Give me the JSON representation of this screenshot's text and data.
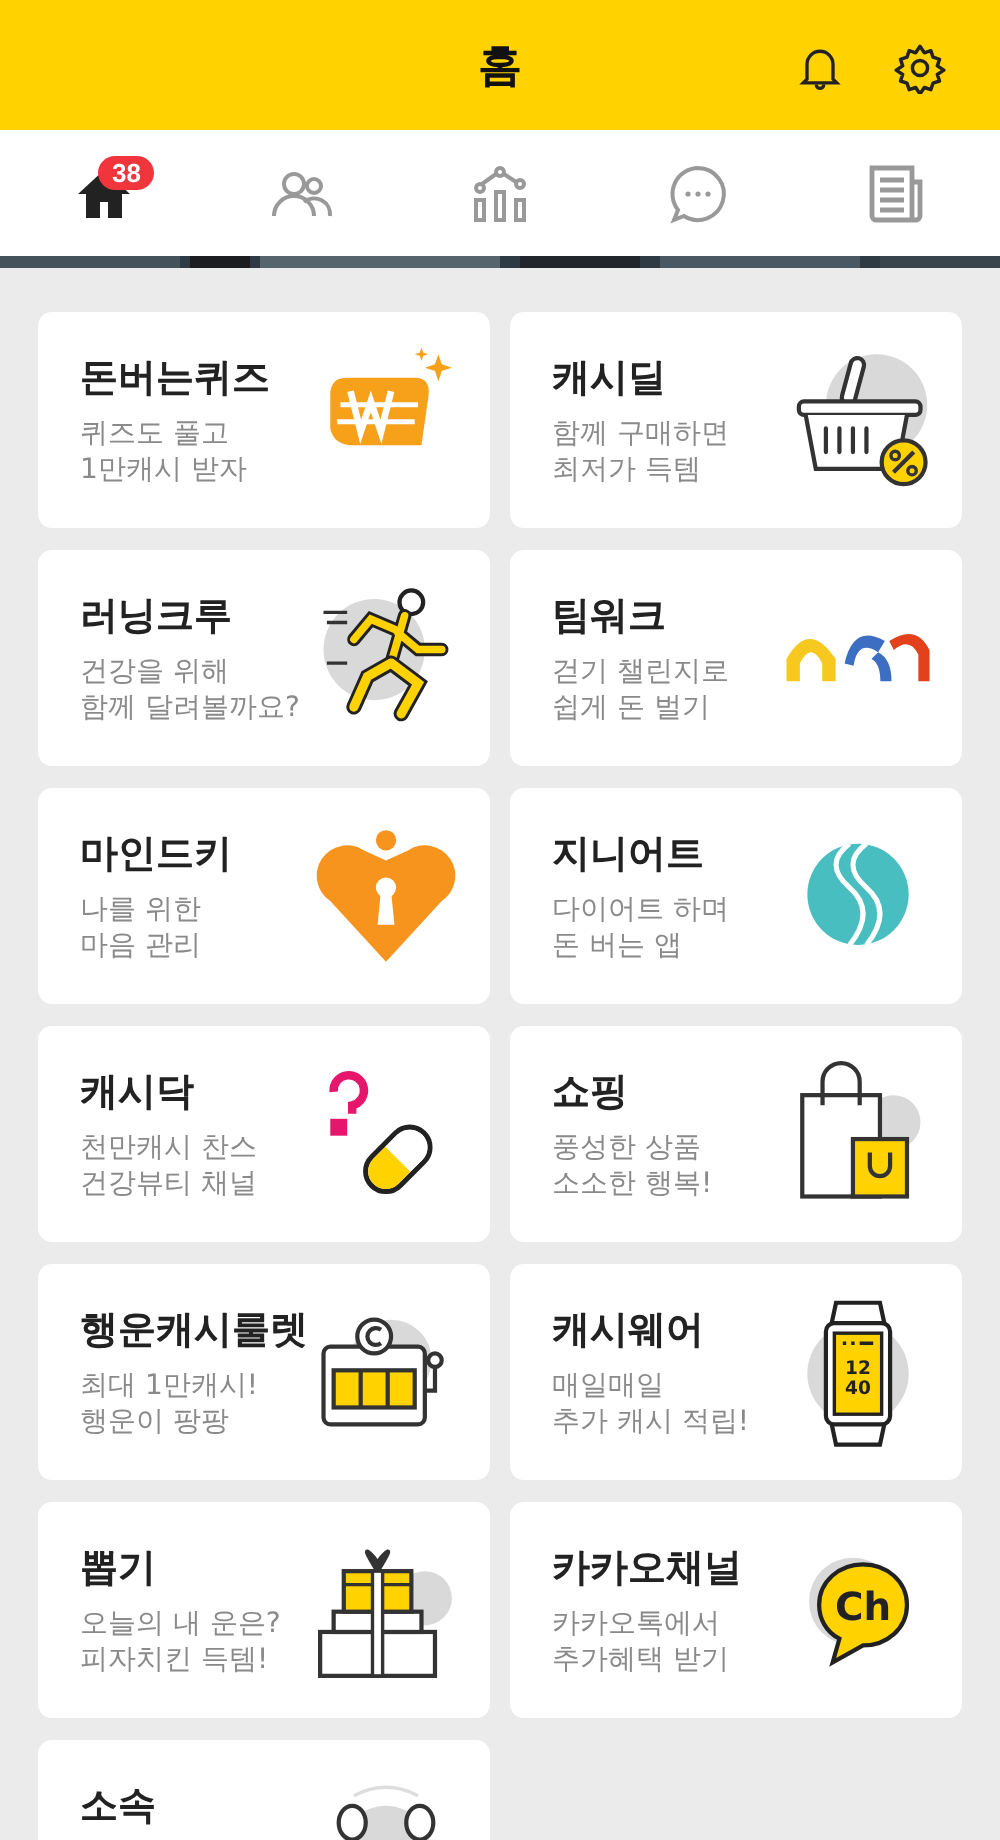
{
  "header": {
    "title": "홈"
  },
  "tabs": [
    {
      "kind": "home",
      "selected": true,
      "badge": "38"
    },
    {
      "kind": "friends",
      "selected": false
    },
    {
      "kind": "stats",
      "selected": false
    },
    {
      "kind": "chat",
      "selected": false
    },
    {
      "kind": "news",
      "selected": false
    }
  ],
  "cards": [
    {
      "title": "돈버는퀴즈",
      "subtitle": [
        "퀴즈도 풀고",
        "1만캐시 받자"
      ],
      "kind": "quiz"
    },
    {
      "title": "캐시딜",
      "subtitle": [
        "함께 구매하면",
        "최저가 득템"
      ],
      "kind": "basket"
    },
    {
      "title": "러닝크루",
      "subtitle": [
        "건강을 위해",
        "함께 달려볼까요?"
      ],
      "kind": "runner"
    },
    {
      "title": "팀워크",
      "subtitle": [
        "걷기 챌린지로",
        "쉽게 돈 벌기"
      ],
      "kind": "arches"
    },
    {
      "title": "마인드키",
      "subtitle": [
        "나를 위한",
        "마음 관리"
      ],
      "kind": "heart"
    },
    {
      "title": "지니어트",
      "subtitle": [
        "다이어트 하며",
        "돈 버는 앱"
      ],
      "kind": "wave"
    },
    {
      "title": "캐시닥",
      "subtitle": [
        "천만캐시 찬스",
        "건강뷰티 채널"
      ],
      "kind": "pill"
    },
    {
      "title": "쇼핑",
      "subtitle": [
        "풍성한 상품",
        "소소한 행복!"
      ],
      "kind": "bag"
    },
    {
      "title": "행운캐시룰렛",
      "subtitle": [
        "최대 1만캐시!",
        "행운이 팡팡"
      ],
      "kind": "slot"
    },
    {
      "title": "캐시웨어",
      "subtitle": [
        "매일매일",
        "추가 캐시 적립!"
      ],
      "kind": "watch",
      "icon_text": [
        "12",
        "40"
      ]
    },
    {
      "title": "뽑기",
      "subtitle": [
        "오늘의 내 운은?",
        "피자치킨 득템!"
      ],
      "kind": "gift"
    },
    {
      "title": "카카오채널",
      "subtitle": [
        "카카오톡에서",
        "추가혜택 받기"
      ],
      "kind": "channel",
      "icon_text": [
        "Ch"
      ]
    },
    {
      "title": "소속",
      "kind": "people"
    }
  ]
}
